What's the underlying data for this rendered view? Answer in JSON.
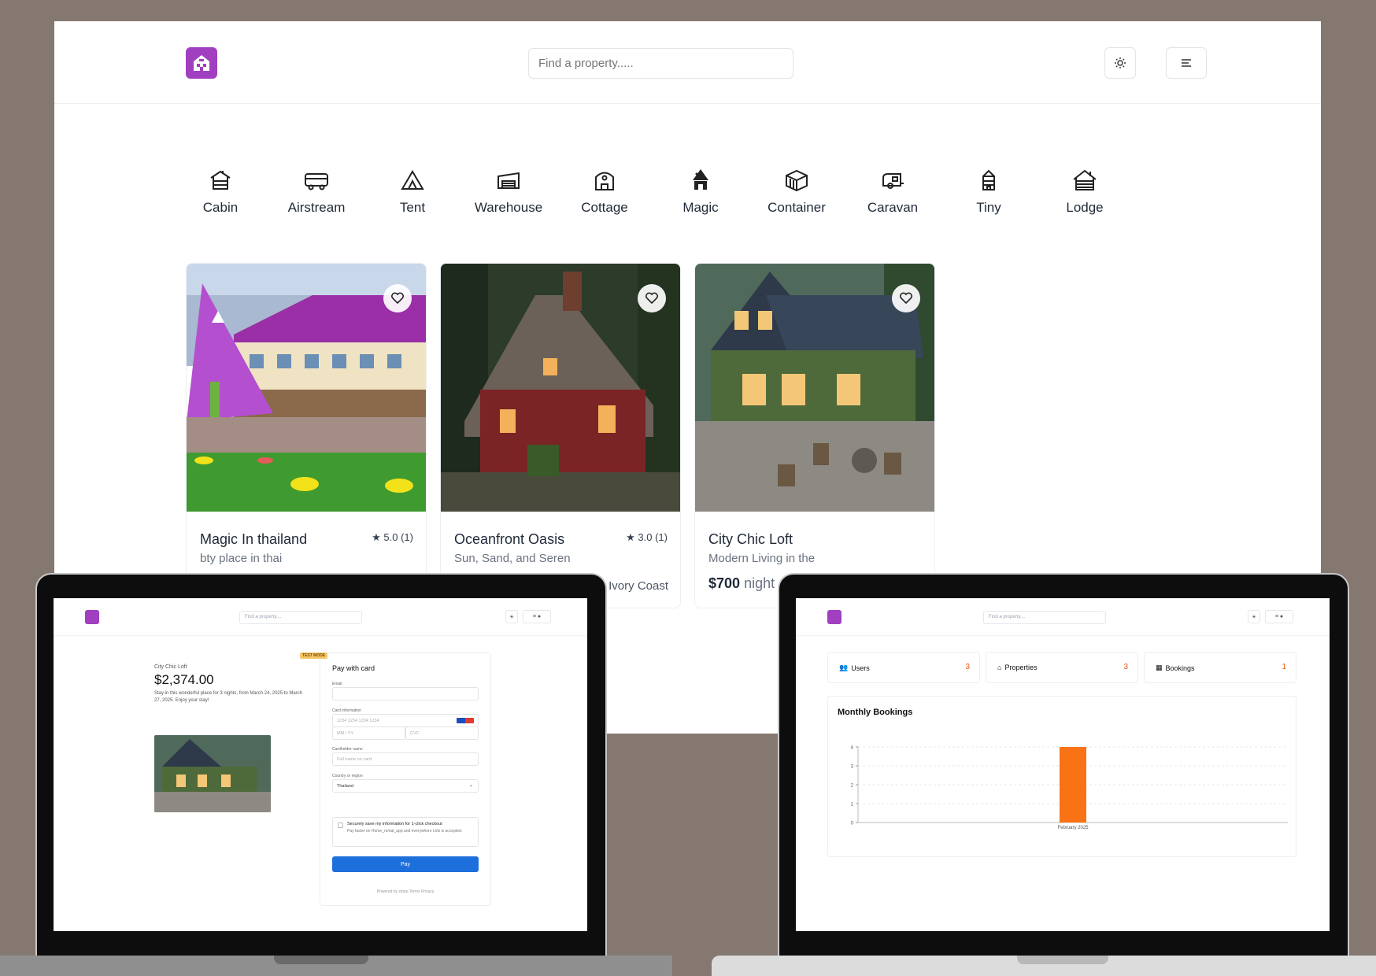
{
  "main": {
    "search_placeholder": "Find a property.....",
    "categories": [
      {
        "label": "Cabin",
        "icon": "cabin-icon"
      },
      {
        "label": "Airstream",
        "icon": "airstream-icon"
      },
      {
        "label": "Tent",
        "icon": "tent-icon"
      },
      {
        "label": "Warehouse",
        "icon": "warehouse-icon"
      },
      {
        "label": "Cottage",
        "icon": "cottage-icon"
      },
      {
        "label": "Magic",
        "icon": "magic-icon"
      },
      {
        "label": "Container",
        "icon": "container-icon"
      },
      {
        "label": "Caravan",
        "icon": "caravan-icon"
      },
      {
        "label": "Tiny",
        "icon": "tiny-icon"
      },
      {
        "label": "Lodge",
        "icon": "lodge-icon"
      }
    ],
    "properties": [
      {
        "name": "Magic In thailand",
        "rating": "5.0 (1)",
        "subtitle": "bty place in thai"
      },
      {
        "name": "Oceanfront Oasis",
        "rating": "3.0 (1)",
        "subtitle": "Sun, Sand, and Seren",
        "location": "Ivory Coast"
      },
      {
        "name": "City Chic Loft",
        "subtitle": "Modern Living in the",
        "price": "$700",
        "price_unit": "night"
      }
    ]
  },
  "checkout": {
    "search_placeholder": "Find a property....",
    "property_name": "City Chic Loft",
    "amount": "$2,374.00",
    "description": "Stay in this wonderful place for 3 nights, from March 24, 2025 to March 27, 2025. Enjoy your stay!",
    "badge": "TEST MODE",
    "heading": "Pay with card",
    "email_label": "Email",
    "card_label": "Card information",
    "card_placeholder": "1234 1234 1234 1234",
    "expiry_placeholder": "MM / YY",
    "cvc_placeholder": "CVC",
    "cardholder_label": "Cardholder name",
    "cardholder_placeholder": "Full name on card",
    "country_label": "Country or region",
    "country_value": "Thailand",
    "save_title": "Securely save my information for 1-click checkout",
    "save_desc": "Pay faster on Home_rental_app and everywhere Link is accepted.",
    "pay_label": "Pay",
    "footer": "Powered by stripe   Terms   Privacy"
  },
  "dashboard": {
    "search_placeholder": "Find a property....",
    "stats": [
      {
        "label": "Users",
        "value": "3",
        "icon": "users-icon"
      },
      {
        "label": "Properties",
        "value": "3",
        "icon": "home-icon"
      },
      {
        "label": "Bookings",
        "value": "1",
        "icon": "calendar-icon"
      }
    ],
    "chart_title": "Monthly Bookings"
  },
  "chart_data": {
    "type": "bar",
    "title": "Monthly Bookings",
    "categories": [
      "February 2025"
    ],
    "values": [
      4
    ],
    "ylim": [
      0,
      4
    ],
    "yticks": [
      0,
      1,
      2,
      3,
      4
    ],
    "grid": true,
    "color": "#f97316"
  },
  "colors": {
    "brand": "#a13fc1",
    "accent": "#ea580c",
    "pay_button": "#1d6fdc"
  }
}
